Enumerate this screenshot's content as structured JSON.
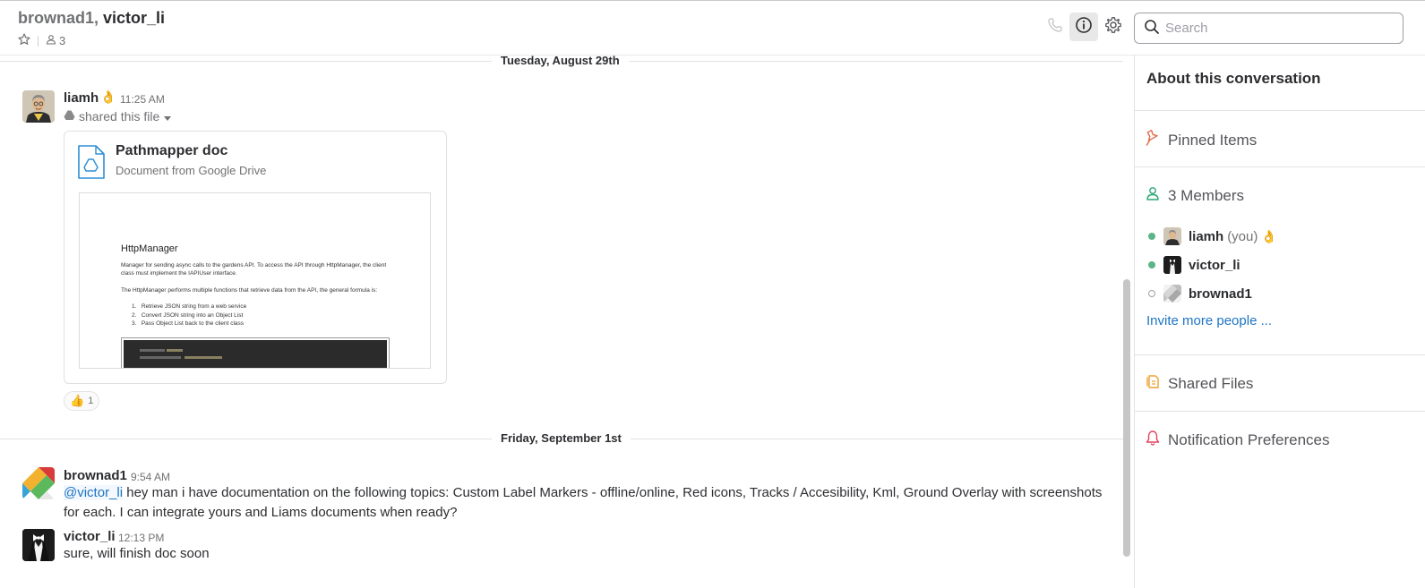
{
  "header": {
    "title_part1": "brownad1,",
    "title_part2": "victor_li",
    "member_count": "3",
    "search_placeholder": "Search"
  },
  "dividers": [
    "Tuesday, August 29th",
    "Friday, September 1st"
  ],
  "messages": [
    {
      "sender": "liamh",
      "status_emoji": "👌",
      "time": "11:25 AM",
      "action": "shared this file",
      "file": {
        "title": "Pathmapper doc",
        "subtitle": "Document from Google Drive",
        "preview": {
          "heading": "HttpManager",
          "p1": "Manager for sending async calls to the gardens API. To access the API through HttpManager, the client class must implement the IAPIUser interface.",
          "p2": "The HttpManager performs multiple functions that retrieve data from the API, the general formula is:",
          "list": [
            "Retrieve JSON string from a web service",
            "Convert JSON string into an Object List",
            "Pass Object List back to the client class"
          ]
        }
      },
      "reaction": {
        "emoji": "👍",
        "count": "1"
      }
    },
    {
      "sender": "brownad1",
      "time": "9:54 AM",
      "mention": "@victor_li",
      "text_line1": " hey man i have documentation on the following topics:  Custom Label Markers - offline/online, Red icons, Tracks / Accesibility, Kml, Ground Overlay with screenshots",
      "text_line2": "for each. I can integrate yours and Liams documents when ready?"
    },
    {
      "sender": "victor_li",
      "time": "12:13 PM",
      "text": "sure, will finish doc soon"
    }
  ],
  "panel": {
    "title": "About this conversation",
    "pinned": "Pinned Items",
    "members_label": "3 Members",
    "members": [
      {
        "name": "liamh",
        "you": "(you)",
        "emoji": "👌",
        "status": "online"
      },
      {
        "name": "victor_li",
        "status": "online"
      },
      {
        "name": "brownad1",
        "status": "away"
      }
    ],
    "invite": "Invite more people ...",
    "shared_files": "Shared Files",
    "notifications": "Notification Preferences"
  },
  "colors": {
    "online": "#5cb589",
    "link": "#1d74c4",
    "pin_icon": "#e06b4b",
    "members_icon": "#2aa876",
    "files_icon": "#f0a030",
    "bell_icon": "#e0425a"
  }
}
